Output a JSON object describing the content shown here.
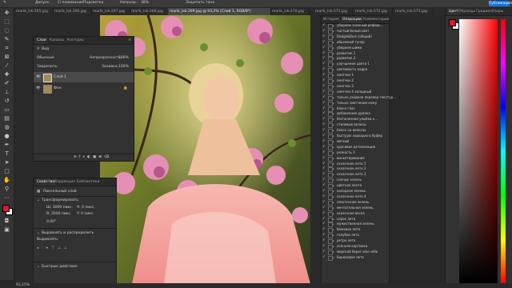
{
  "optbar": {
    "items": [
      "Допуск:",
      "Сглаживание",
      "Подсветка",
      "Непрозр.:",
      "38%",
      "Защитить тона"
    ],
    "publish": "Публикация"
  },
  "tabs": [
    {
      "label": "marik_lsk-265.jpg"
    },
    {
      "label": "marik_lsk-266.jpg"
    },
    {
      "label": "marik_lsk-267.jpg"
    },
    {
      "label": "marik_lsk-268.jpg"
    },
    {
      "label": "marik_lsk-269.jpg @ 93,2% (Слой 1, RGB/8*)"
    },
    {
      "label": "marik_lsk-270.jpg"
    },
    {
      "label": "marik_lsk-271.jpg"
    },
    {
      "label": "marik_lsk-272.jpg"
    },
    {
      "label": "marik_lsk-273.jpg"
    }
  ],
  "layers": {
    "tabs": [
      "Слои",
      "Каналы",
      "Контуры"
    ],
    "kind": "Вид",
    "blend": "Обычные",
    "opacity_label": "Непрозрачность:",
    "opacity_value": "100%",
    "lock_label": "Закрепить:",
    "fill_label": "Заливка:",
    "fill_value": "100%",
    "items": [
      {
        "name": "Слой 1"
      },
      {
        "name": "Фон"
      }
    ]
  },
  "properties": {
    "tabs": [
      "Свойства",
      "Коррекция",
      "Библиотеки"
    ],
    "pixel_layer": "Пиксельный слой",
    "transform_title": "Трансформировать",
    "w": "Ш: 3000 пикс.",
    "h": "В: 2000 пикс.",
    "x": "X: 0 пикс.",
    "y": "Y: 0 пикс.",
    "angle": "0,00°",
    "align_title": "Выровнять и распределить",
    "align_sub": "Выровнять:",
    "quick_title": "Быстрые действия"
  },
  "history": {
    "tabs": [
      "История",
      "Операции",
      "Комментарии"
    ]
  },
  "actions": [
    "убираем заменый реферь...",
    "чистый белый свет",
    "Dodge&Burn (общий)",
    "обьемный тунер",
    "убираем шими",
    "развитие 1",
    "развитие 2",
    "улучшение цвета 1",
    "светимость кадра",
    "смягчен 1",
    "смягчен 2",
    "смягчен 3",
    "смягчен 4 холодный",
    "только уходное перевод текстур...",
    "только смягчение кожу",
    "блеск глаз",
    "добавление румяна",
    "бесполезная улыбка к...",
    "стилевые волосы",
    "блеск на волосах",
    "быструю хорошую в буфер",
    "мягкий",
    "красивое детализация",
    "резкость 1",
    "виньетирование",
    "сказочное лето 1",
    "сказочное лето 2",
    "сказочное лето 3",
    "солнце зелень",
    "цветная лента",
    "холодная зелень",
    "сказочное лето 4",
    "пластичная зелень",
    "мечтательная зелень",
    "сказочная весна",
    "сорок лета",
    "мужественная зелень",
    "бежевое лето",
    "голубое лето",
    "ретро лето",
    "осенняя картинка",
    "морской берег или небо",
    "бирюзовое лето"
  ],
  "colorpanel": {
    "tabs": [
      "Цвет",
      "Образцы",
      "Градиен",
      "Узоры"
    ]
  },
  "status": {
    "zoom": "93,15%"
  },
  "colors": {
    "accent": "#1473e6",
    "foreground": "#e0152a",
    "background": "#ffffff"
  }
}
